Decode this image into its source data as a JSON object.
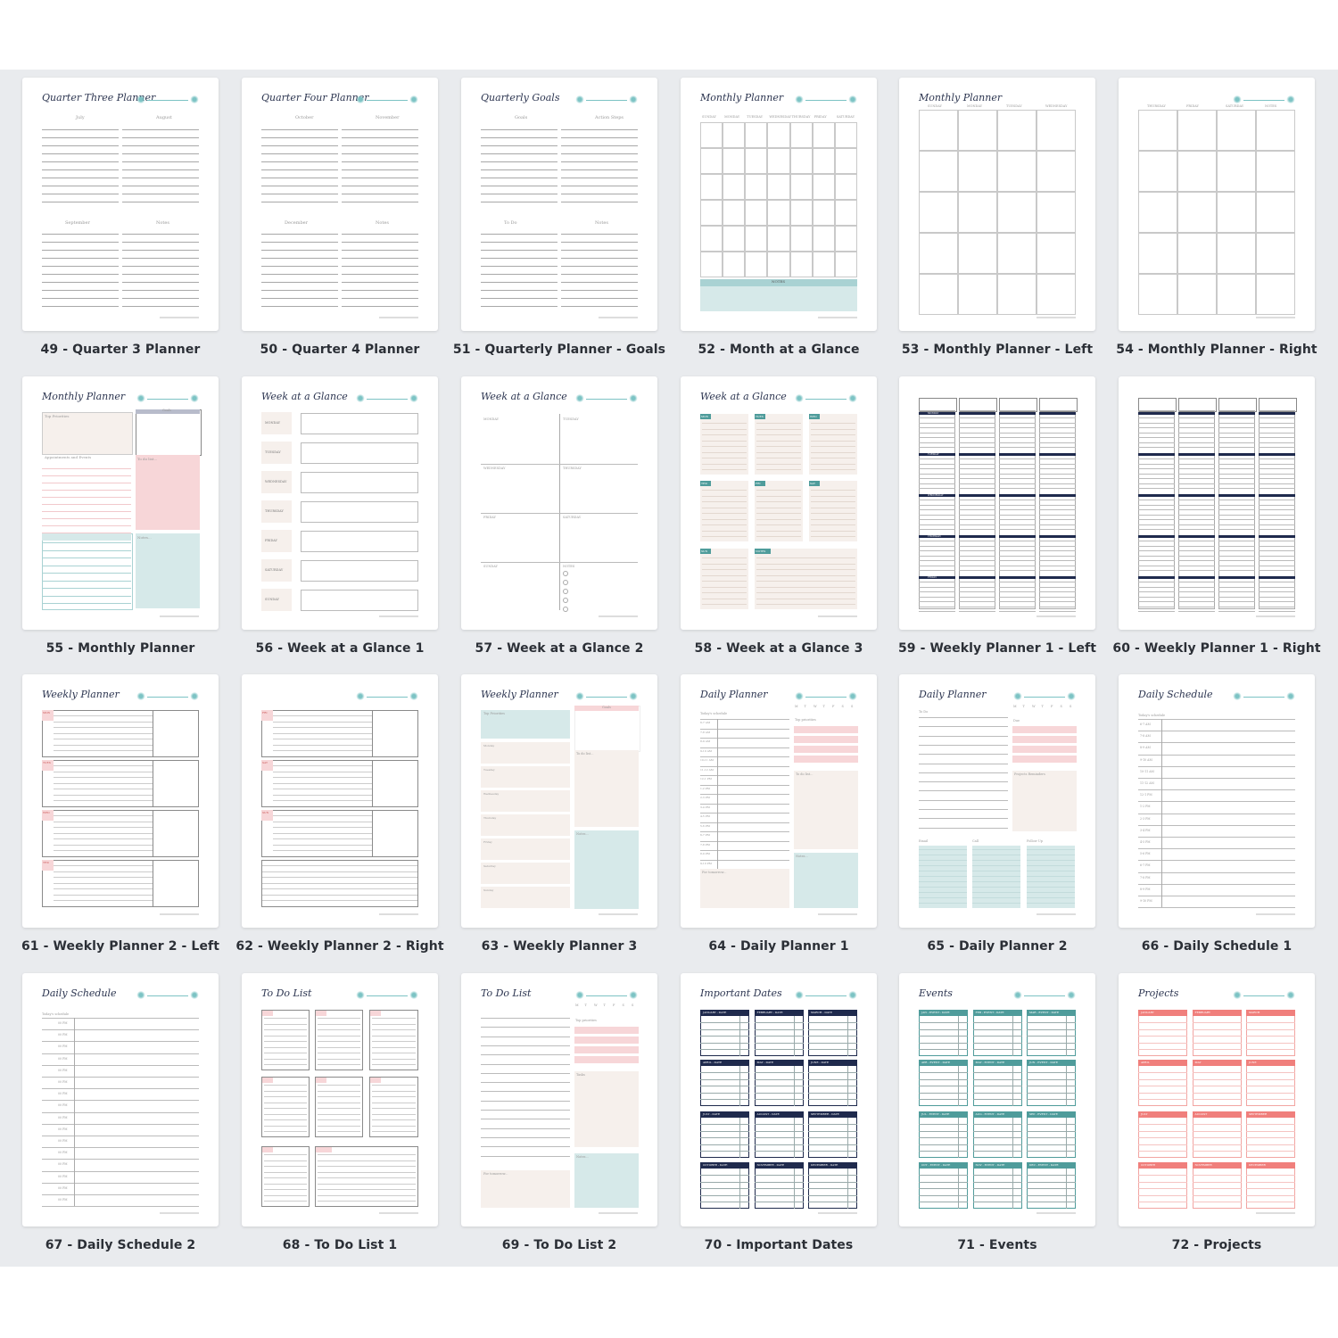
{
  "colors": {
    "background_band": "#e9ebee",
    "navy": "#1f2a4d",
    "teal": "#4f9c9b",
    "teal_light": "#d6e9e9",
    "pink": "#f7d6d8",
    "coral": "#f07f7c",
    "beige": "#f6f0ec"
  },
  "templates": [
    {
      "id": 49,
      "caption": "49 - Quarter 3 Planner",
      "title": "Quarter Three Planner",
      "kind": "quarter",
      "labels": [
        "July",
        "August",
        "September",
        "Notes"
      ]
    },
    {
      "id": 50,
      "caption": "50 - Quarter 4 Planner",
      "title": "Quarter Four Planner",
      "kind": "quarter",
      "labels": [
        "October",
        "November",
        "December",
        "Notes"
      ]
    },
    {
      "id": 51,
      "caption": "51 - Quarterly Planner - Goals",
      "title": "Quarterly Goals",
      "kind": "quarter",
      "labels": [
        "Goals",
        "Action Steps",
        "To Do",
        "Notes"
      ]
    },
    {
      "id": 52,
      "caption": "52 - Month at a Glance",
      "title": "Monthly Planner",
      "kind": "month7",
      "labels": [
        "SUNDAY",
        "MONDAY",
        "TUESDAY",
        "WEDNESDAY",
        "THURSDAY",
        "FRIDAY",
        "SATURDAY",
        "NOTES"
      ]
    },
    {
      "id": 53,
      "caption": "53 - Monthly Planner - Left",
      "title": "Monthly Planner",
      "kind": "month4",
      "labels": [
        "SUNDAY",
        "MONDAY",
        "TUESDAY",
        "WEDNESDAY"
      ]
    },
    {
      "id": 54,
      "caption": "54 - Monthly Planner - Right",
      "title": "",
      "kind": "month4",
      "labels": [
        "THURSDAY",
        "FRIDAY",
        "SATURDAY",
        "NOTES"
      ]
    },
    {
      "id": 55,
      "caption": "55 - Monthly Planner",
      "title": "Monthly Planner",
      "kind": "monthly-boxes",
      "labels": [
        "Top Priorities",
        "Goals",
        "Appointments and Events",
        "To do list...",
        "Notes..."
      ]
    },
    {
      "id": 56,
      "caption": "56 - Week at a Glance 1",
      "title": "Week at a Glance",
      "kind": "week-rows",
      "labels": [
        "MONDAY",
        "TUESDAY",
        "WEDNESDAY",
        "THURSDAY",
        "FRIDAY",
        "SATURDAY",
        "SUNDAY"
      ]
    },
    {
      "id": 57,
      "caption": "57 - Week at a Glance 2",
      "title": "Week at a Glance",
      "kind": "week-quad",
      "labels": [
        "MONDAY",
        "TUESDAY",
        "WEDNESDAY",
        "THURSDAY",
        "FRIDAY",
        "SATURDAY",
        "SUNDAY",
        "NOTES"
      ]
    },
    {
      "id": 58,
      "caption": "58 - Week at a Glance 3",
      "title": "Week at a Glance",
      "kind": "week-tiles",
      "labels": [
        "MON",
        "TUES",
        "WED",
        "THU",
        "FRI",
        "SAT",
        "SUN",
        "NOTES"
      ]
    },
    {
      "id": 59,
      "caption": "59 - Weekly Planner 1 - Left",
      "title": "",
      "kind": "weekly-cols",
      "labels": [
        "MONDAY",
        "TUESDAY",
        "WEDNESDAY",
        "THURSDAY",
        "FRIDAY"
      ]
    },
    {
      "id": 60,
      "caption": "60 - Weekly Planner 1 - Right",
      "title": "",
      "kind": "weekly-cols",
      "labels": []
    },
    {
      "id": 61,
      "caption": "61 - Weekly Planner 2 - Left",
      "title": "Weekly Planner",
      "kind": "weekly-boxes",
      "labels": [
        "MON",
        "TUES",
        "WED",
        "THU"
      ]
    },
    {
      "id": 62,
      "caption": "62 - Weekly Planner 2 - Right",
      "title": "",
      "kind": "weekly-boxes",
      "labels": [
        "FRI",
        "SAT",
        "SUN"
      ]
    },
    {
      "id": 63,
      "caption": "63 - Weekly Planner 3",
      "title": "Weekly Planner",
      "kind": "weekly3",
      "labels": [
        "Top Priorities",
        "Goals",
        "Monday",
        "Tuesday",
        "Wednesday",
        "Thursday",
        "Friday",
        "Saturday",
        "Sunday",
        "To do list...",
        "Notes..."
      ]
    },
    {
      "id": 64,
      "caption": "64 - Daily Planner 1",
      "title": "Daily Planner",
      "kind": "daily1",
      "labels": [
        "Today's schedule",
        "Top priorities",
        "To do list...",
        "Notes...",
        "For tomorrow..."
      ]
    },
    {
      "id": 65,
      "caption": "65 - Daily Planner 2",
      "title": "Daily Planner",
      "kind": "daily2",
      "labels": [
        "To Do",
        "Due",
        "Projects Reminders",
        "Email",
        "Call",
        "Follow Up"
      ]
    },
    {
      "id": 66,
      "caption": "66 - Daily Schedule 1",
      "title": "Daily Schedule",
      "kind": "schedule",
      "labels": [
        "Today's schedule"
      ]
    },
    {
      "id": 67,
      "caption": "67 - Daily Schedule 2",
      "title": "Daily Schedule",
      "kind": "schedule",
      "labels": [
        "Today's schedule"
      ]
    },
    {
      "id": 68,
      "caption": "68 - To Do List 1",
      "title": "To Do List",
      "kind": "todo1",
      "labels": []
    },
    {
      "id": 69,
      "caption": "69 - To Do List 2",
      "title": "To Do List",
      "kind": "todo2",
      "labels": [
        "Top priorities",
        "Tasks",
        "Notes...",
        "For tomorrow..."
      ]
    },
    {
      "id": 70,
      "caption": "70 - Important Dates",
      "title": "Important Dates",
      "kind": "months12",
      "labels": [
        "JANUARY - DATE",
        "FEBRUARY - DATE",
        "MARCH - DATE",
        "APRIL - DATE",
        "MAY - DATE",
        "JUNE - DATE",
        "JULY - DATE",
        "AUGUST - DATE",
        "SEPTEMBER - DATE",
        "OCTOBER - DATE",
        "NOVEMBER - DATE",
        "DECEMBER - DATE"
      ]
    },
    {
      "id": 71,
      "caption": "71 - Events",
      "title": "Events",
      "kind": "months12",
      "labels": [
        "JAN - EVENT - DATE",
        "FEB - EVENT - DATE",
        "MAR - EVENT - DATE",
        "APR - EVENT - DATE",
        "MAY - EVENT - DATE",
        "JUN - EVENT - DATE",
        "JUL - EVENT - DATE",
        "AUG - EVENT - DATE",
        "SEP - EVENT - DATE",
        "OCT - EVENT - DATE",
        "NOV - EVENT - DATE",
        "DEC - EVENT - DATE"
      ]
    },
    {
      "id": 72,
      "caption": "72 - Projects",
      "title": "Projects",
      "kind": "months12",
      "labels": [
        "JANUARY",
        "FEBRUARY",
        "MARCH",
        "APRIL",
        "MAY",
        "JUNE",
        "JULY",
        "AUGUST",
        "SEPTEMBER",
        "OCTOBER",
        "NOVEMBER",
        "DECEMBER"
      ]
    }
  ],
  "schedule_times_66": [
    "6-7 AM",
    "7-8 AM",
    "8-9 AM",
    "9-10 AM",
    "10-11 AM",
    "11-12 AM",
    "12-1 PM",
    "1-2 PM",
    "2-3 PM",
    "3-4 PM",
    "4-5 PM",
    "5-6 PM",
    "6-7 PM",
    "7-8 PM",
    "8-9 PM",
    "9-10 PM"
  ],
  "schedule_times_67": [
    "00 PM",
    "00 PM",
    "00 PM",
    "00 PM",
    "00 PM",
    "00 PM",
    "00 PM",
    "00 PM",
    "00 PM",
    "00 PM",
    "00 PM",
    "00 PM",
    "00 PM",
    "00 PM",
    "00 PM",
    "00 PM"
  ],
  "weekdays_short": [
    "M",
    "T",
    "W",
    "T",
    "F",
    "S",
    "S"
  ]
}
